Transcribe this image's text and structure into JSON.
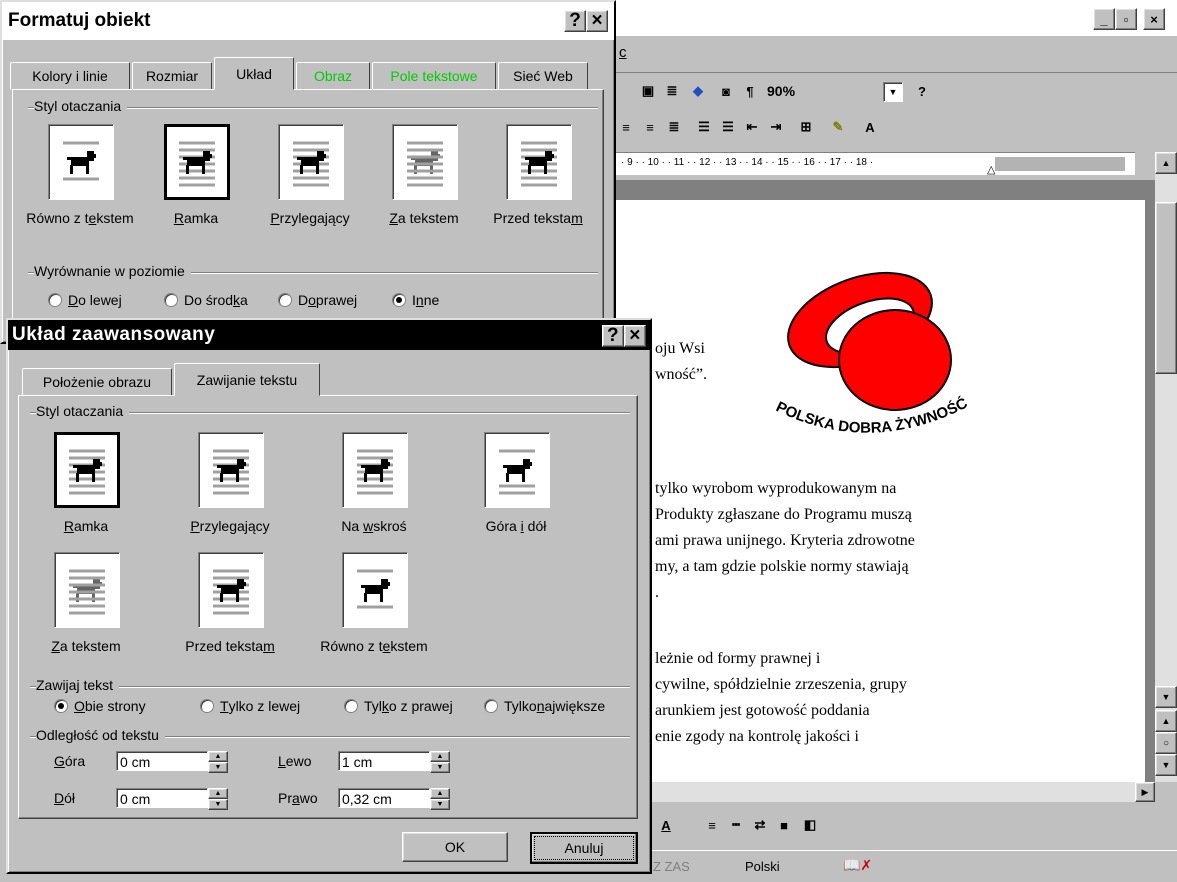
{
  "word": {
    "menu_partial": "c",
    "zoom": "90%",
    "ruler_text": "· 9 · · 10 · · 11 · · 12 · · 13 · · 14 · · 15 · · 16 · · 17 · · 18 ·",
    "doc_lines": [
      "oju Wsi",
      "wność”.",
      "tylko wyrobom wyprodukowanym na",
      "Produkty zgłaszane do Programu muszą",
      "ami prawa unijnego. Kryteria zdrowotne",
      "my, a tam gdzie polskie normy stawiają",
      ".",
      "leżnie od formy prawnej i",
      "cywilne, spółdzielnie zrzeszenia, grupy",
      "arunkiem jest gotowość poddania",
      "enie zgody na kontrolę jakości i"
    ],
    "logo_text": "POLSKA DOBRA ŻYWNOŚĆ",
    "status": {
      "zas": "Z ZAS",
      "lang": "Polski"
    },
    "colors": {
      "logo_red": "#ff0000"
    }
  },
  "format_dialog": {
    "title": "Formatuj obiekt",
    "help": "?",
    "close": "×",
    "tabs": [
      "Kolory i linie",
      "Rozmiar",
      "Układ",
      "Obraz",
      "Pole tekstowe",
      "Sieć Web"
    ],
    "active_tab": "Układ",
    "wrap_group": "Styl otaczania",
    "wrap_styles": [
      {
        "pre": "Równo z t",
        "ul": "e",
        "post": "kstem",
        "selected": false
      },
      {
        "pre": "",
        "ul": "R",
        "post": "amka",
        "selected": true
      },
      {
        "pre": "",
        "ul": "P",
        "post": "rzylegający",
        "selected": false
      },
      {
        "pre": "",
        "ul": "Z",
        "post": "a tekstem",
        "selected": false
      },
      {
        "pre": "Przed teksta",
        "ul": "m",
        "post": "",
        "selected": false
      }
    ],
    "halign_group": "Wyrównanie w poziomie",
    "halign": [
      {
        "pre": "",
        "ul": "D",
        "post": "o lewej",
        "on": false
      },
      {
        "pre": "Do środ",
        "ul": "k",
        "post": "a",
        "on": false
      },
      {
        "pre": "D",
        "ul": "o",
        "post": " prawej",
        "on": false
      },
      {
        "pre": "I",
        "ul": "n",
        "post": "ne",
        "on": true
      }
    ]
  },
  "adv_dialog": {
    "title": "Układ zaawansowany",
    "help": "?",
    "close": "×",
    "tabs": [
      "Położenie obrazu",
      "Zawijanie tekstu"
    ],
    "active_tab": "Zawijanie tekstu",
    "wrap_group": "Styl otaczania",
    "wrap_styles": [
      {
        "pre": "",
        "ul": "R",
        "post": "amka",
        "selected": true
      },
      {
        "pre": "",
        "ul": "P",
        "post": "rzylegający",
        "selected": false
      },
      {
        "pre": "Na ",
        "ul": "w",
        "post": "skroś",
        "selected": false
      },
      {
        "pre": "Góra ",
        "ul": "i",
        "post": " dół",
        "selected": false
      },
      {
        "pre": "",
        "ul": "Z",
        "post": "a tekstem",
        "selected": false
      },
      {
        "pre": "Przed teksta",
        "ul": "m",
        "post": "",
        "selected": false
      },
      {
        "pre": "Równo z t",
        "ul": "e",
        "post": "kstem",
        "selected": false
      }
    ],
    "wrap_text_group": "Zawijaj tekst",
    "wrap_text": [
      {
        "pre": "",
        "ul": "O",
        "post": "bie strony",
        "on": true
      },
      {
        "pre": "",
        "ul": "T",
        "post": "ylko z lewej",
        "on": false
      },
      {
        "pre": "Tyl",
        "ul": "k",
        "post": "o z prawej",
        "on": false
      },
      {
        "pre": "Tylko ",
        "ul": "n",
        "post": "ajwiększe",
        "on": false
      }
    ],
    "distance_group": "Odległość od tekstu",
    "distance": {
      "top_label_ul": "G",
      "top_label_rest": "óra",
      "top_value": "0 cm",
      "bottom_label_ul": "D",
      "bottom_label_rest": "ół",
      "bottom_value": "0 cm",
      "left_label_ul": "L",
      "left_label_rest": "ewo",
      "left_value": "1 cm",
      "right_label_pre": "Pr",
      "right_label_ul": "a",
      "right_label_rest": "wo",
      "right_value": "0,32 cm"
    },
    "ok": "OK",
    "cancel": "Anuluj"
  }
}
